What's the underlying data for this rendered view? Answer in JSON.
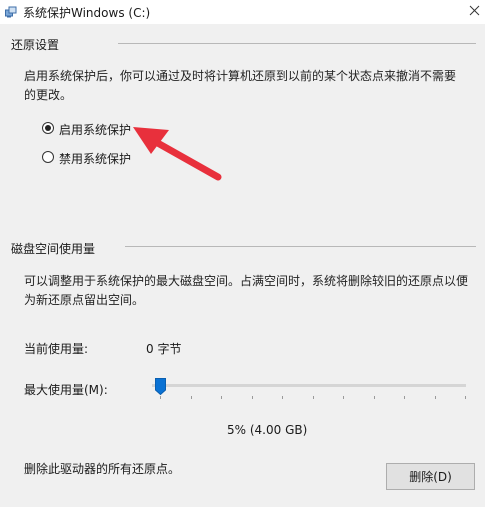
{
  "window": {
    "title": "系统保护Windows (C:)",
    "icon": "system-protection-icon",
    "close_icon": "close-icon"
  },
  "restore_settings": {
    "heading": "还原设置",
    "description": "启用系统保护后，你可以通过及时将计算机还原到以前的某个状态点来撤消不需要的更改。",
    "options": [
      {
        "label": "启用系统保护",
        "selected": true
      },
      {
        "label": "禁用系统保护",
        "selected": false
      }
    ]
  },
  "annotation": {
    "icon": "red-arrow-pointer",
    "color": "#e8303c"
  },
  "disk_usage": {
    "heading": "磁盘空间使用量",
    "description": "可以调整用于系统保护的最大磁盘空间。占满空间时，系统将删除较旧的还原点以便为新还原点留出空间。",
    "current_label": "当前使用量:",
    "current_value": "0 字节",
    "max_label": "最大使用量(M):",
    "max_percent": 5,
    "max_value_text": "5% (4.00 GB)",
    "slider_accent": "#0a72d4"
  },
  "delete": {
    "text": "删除此驱动器的所有还原点。",
    "button_label": "删除(D)"
  }
}
